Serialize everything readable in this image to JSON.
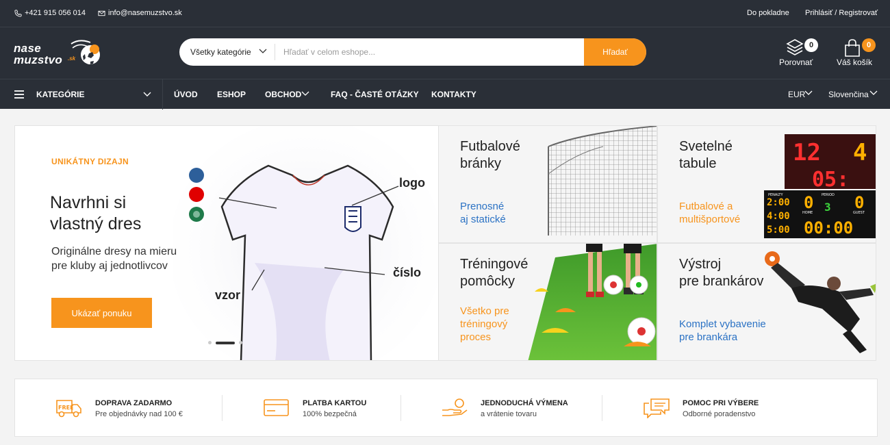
{
  "topbar": {
    "phone": "+421 915 056 014",
    "email": "info@nasemuzstvo.sk",
    "checkout": "Do pokladne",
    "login": "Prihlásiť / Registrovať"
  },
  "logo": {
    "line1": "nase",
    "line2": "muzstvo",
    "suffix": ".sk"
  },
  "search": {
    "category": "Všetky kategórie",
    "placeholder": "Hľadať v celom eshope...",
    "button": "Hľadať"
  },
  "compare": {
    "label": "Porovnať",
    "count": "0"
  },
  "cart": {
    "label": "Váš košík",
    "count": "0"
  },
  "nav": {
    "categories": "KATEGÓRIE",
    "items": [
      "ÚVOD",
      "ESHOP",
      "OBCHOD",
      "FAQ - ČASTÉ OTÁZKY",
      "KONTAKTY"
    ],
    "currency": "EUR",
    "language": "Slovenčina"
  },
  "hero": {
    "tag": "UNIKÁTNY DIZAJN",
    "title": "Navrhni si\nvlastný dres",
    "subtitle": "Originálne dresy na mieru\npre kluby aj jednotlivcov",
    "cta": "Ukázať ponuku",
    "annotations": {
      "logo": "logo",
      "number": "číslo",
      "pattern": "vzor"
    }
  },
  "tiles": [
    {
      "title": "Futbalové\nbránky",
      "subtitle": "Prenosné\naj statické",
      "color": "#2b72c4"
    },
    {
      "title": "Svetelné\ntabule",
      "subtitle": "Futbalové a\nmultišportové",
      "color": "#f7941d"
    },
    {
      "title": "Tréningové\npomôcky",
      "subtitle": "Všetko pre\ntréningový\nproces",
      "color": "#f7941d"
    },
    {
      "title": "Výstroj\npre brankárov",
      "subtitle": "Komplet vybavenie\npre brankára",
      "color": "#2b72c4"
    }
  ],
  "scoreboard": {
    "top_left": "12",
    "top_right": "4",
    "time_top": "05:",
    "penalty_label": "PENALTY",
    "penalty_rows": [
      "2:00",
      "4:00",
      "5:00"
    ],
    "home_label": "HOME",
    "home_score": "0",
    "period_label": "PERIOD",
    "period": "3",
    "guest_label": "GUEST",
    "guest_score": "0",
    "clock": "00:00"
  },
  "features": [
    {
      "icon": "free-delivery-icon",
      "title": "DOPRAVA ZADARMO",
      "subtitle": "Pre objednávky nad 100 €",
      "badge": "FREE"
    },
    {
      "icon": "credit-card-icon",
      "title": "PLATBA KARTOU",
      "subtitle": "100% bezpečná"
    },
    {
      "icon": "money-return-icon",
      "title": "JEDNODUCHÁ VÝMENA",
      "subtitle": "a vrátenie tovaru"
    },
    {
      "icon": "chat-support-icon",
      "title": "POMOC PRI VÝBERE",
      "subtitle": "Odborné poradenstvo"
    }
  ],
  "colors": {
    "dark": "#2a2f37",
    "accent": "#f7941d",
    "blue": "#2b72c4"
  }
}
